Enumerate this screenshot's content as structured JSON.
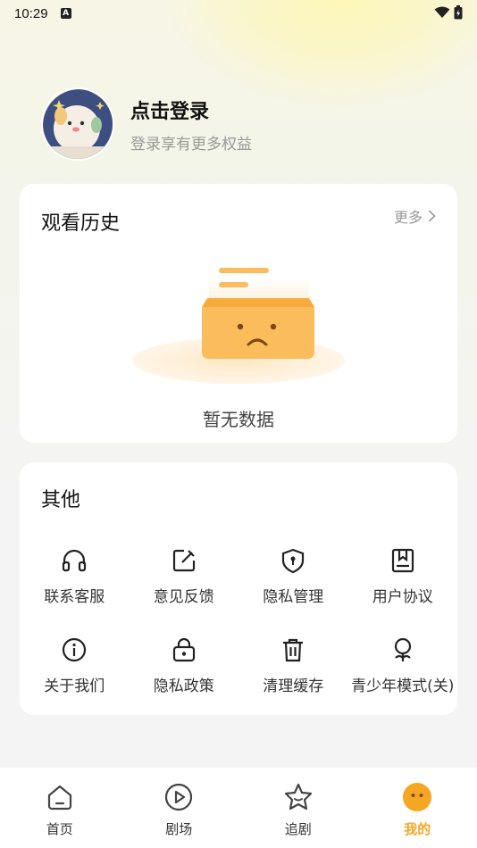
{
  "status_bar": {
    "time": "10:29",
    "notification_letter": "A"
  },
  "profile": {
    "title": "点击登录",
    "subtitle": "登录享有更多权益"
  },
  "history": {
    "title": "观看历史",
    "more_label": "更多",
    "empty_text": "暂无数据"
  },
  "other": {
    "title": "其他",
    "items": [
      {
        "label": "联系客服",
        "icon": "headphones-icon"
      },
      {
        "label": "意见反馈",
        "icon": "edit-icon"
      },
      {
        "label": "隐私管理",
        "icon": "shield-lock-icon"
      },
      {
        "label": "用户协议",
        "icon": "bookmark-book-icon"
      },
      {
        "label": "关于我们",
        "icon": "info-icon"
      },
      {
        "label": "隐私政策",
        "icon": "lock-icon"
      },
      {
        "label": "清理缓存",
        "icon": "trash-icon"
      },
      {
        "label": "青少年模式(关)",
        "icon": "youth-mode-icon"
      }
    ]
  },
  "tabbar": {
    "tabs": [
      {
        "label": "首页",
        "icon": "home-icon"
      },
      {
        "label": "剧场",
        "icon": "play-icon"
      },
      {
        "label": "追剧",
        "icon": "star-face-icon"
      },
      {
        "label": "我的",
        "icon": "smiley-avatar-icon",
        "active": true
      }
    ]
  },
  "colors": {
    "accent": "#f5a623",
    "box": "#fbbd5b"
  }
}
